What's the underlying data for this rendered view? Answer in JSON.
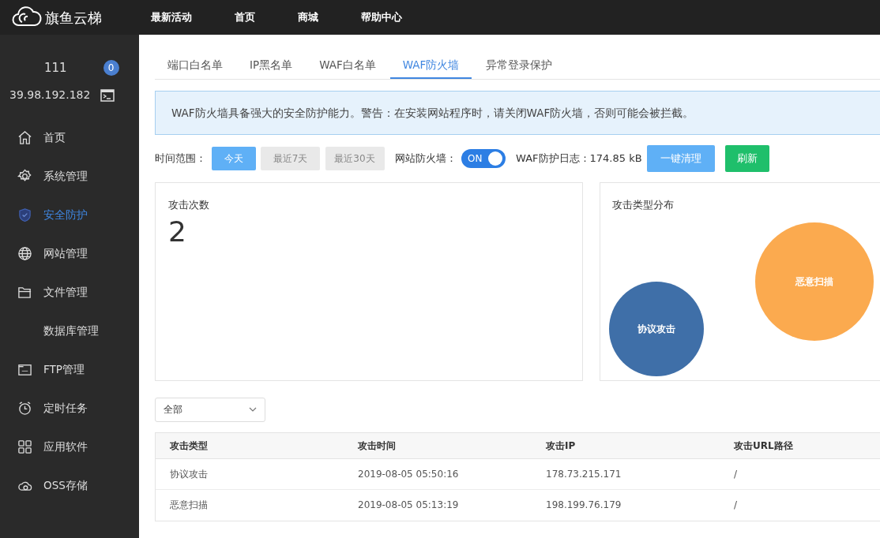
{
  "brand": {
    "name": "旗鱼云梯"
  },
  "top_nav": [
    "最新活动",
    "首页",
    "商城",
    "帮助中心"
  ],
  "user": {
    "name": "111",
    "badge": "0",
    "ip": "39.98.192.182"
  },
  "sidebar": {
    "items": [
      {
        "label": "首页",
        "selected": false
      },
      {
        "label": "系统管理",
        "selected": false
      },
      {
        "label": "安全防护",
        "selected": true
      },
      {
        "label": "网站管理",
        "selected": false
      },
      {
        "label": "文件管理",
        "selected": false
      },
      {
        "label": "数据库管理",
        "selected": false
      },
      {
        "label": "FTP管理",
        "selected": false
      },
      {
        "label": "定时任务",
        "selected": false
      },
      {
        "label": "应用软件",
        "selected": false
      },
      {
        "label": "OSS存储",
        "selected": false
      }
    ]
  },
  "tabs": [
    {
      "label": "端口白名单",
      "selected": false
    },
    {
      "label": "IP黑名单",
      "selected": false
    },
    {
      "label": "WAF白名单",
      "selected": false
    },
    {
      "label": "WAF防火墙",
      "selected": true
    },
    {
      "label": "异常登录保护",
      "selected": false
    }
  ],
  "alert": "WAF防火墙具备强大的安全防护能力。警告：在安装网站程序时，请关闭WAF防火墙，否则可能会被拦截。",
  "toolbar": {
    "range_label": "时间范围：",
    "ranges": [
      {
        "label": "今天",
        "selected": true
      },
      {
        "label": "最近7天",
        "selected": false
      },
      {
        "label": "最近30天",
        "selected": false
      }
    ],
    "firewall_label": "网站防火墙：",
    "firewall": {
      "label": "ON",
      "on": true
    },
    "log_label": "WAF防护日志：174.85 kB",
    "clear_button": "一键清理",
    "refresh_button": "刷新"
  },
  "attack_count": {
    "title": "攻击次数",
    "value": "2"
  },
  "distribution": {
    "title": "攻击类型分布",
    "bubbles": [
      {
        "label": "协议攻击",
        "color": "#3f6fa8"
      },
      {
        "label": "恶意扫描",
        "color": "#fbaa4f"
      }
    ]
  },
  "filter": {
    "value": "全部"
  },
  "table": {
    "columns": [
      "攻击类型",
      "攻击时间",
      "攻击IP",
      "攻击URL路径"
    ],
    "rows": [
      [
        "协议攻击",
        "2019-08-05 05:50:16",
        "178.73.215.171",
        "/"
      ],
      [
        "恶意扫描",
        "2019-08-05 05:13:19",
        "198.199.76.179",
        "/"
      ]
    ]
  }
}
